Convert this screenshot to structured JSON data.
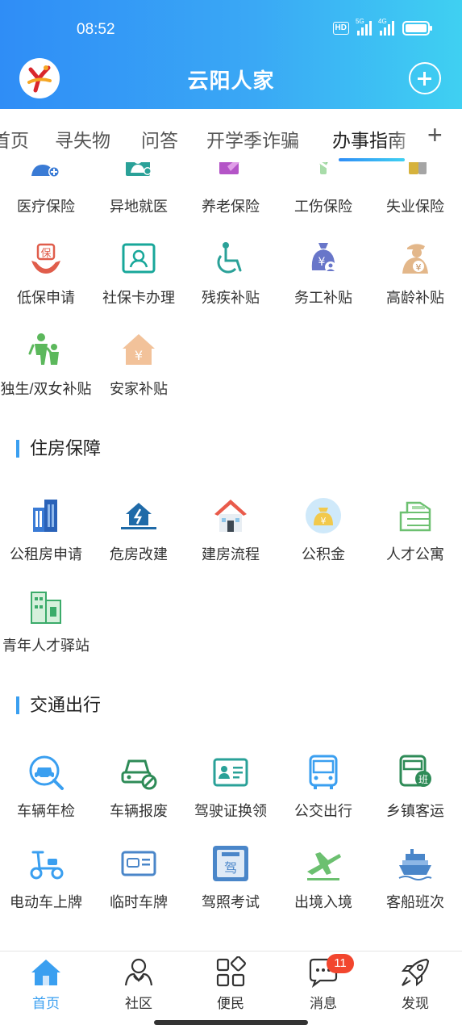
{
  "status_bar": {
    "time": "08:52",
    "hd_label": "HD",
    "net1": "5G",
    "net2": "4G"
  },
  "header": {
    "title": "云阳人家"
  },
  "tabs": [
    {
      "label": "首页"
    },
    {
      "label": "寻失物"
    },
    {
      "label": "问答"
    },
    {
      "label": "开学季诈骗"
    },
    {
      "label": "办事指南"
    }
  ],
  "sections": {
    "social_security": {
      "items": [
        {
          "label": "医疗保险",
          "icon": "medical-insurance-icon"
        },
        {
          "label": "异地就医",
          "icon": "remote-medical-icon"
        },
        {
          "label": "养老保险",
          "icon": "pension-insurance-icon"
        },
        {
          "label": "工伤保险",
          "icon": "injury-insurance-icon"
        },
        {
          "label": "失业保险",
          "icon": "unemployment-insurance-icon"
        },
        {
          "label": "低保申请",
          "icon": "subsistence-allowance-icon"
        },
        {
          "label": "社保卡办理",
          "icon": "social-security-card-icon"
        },
        {
          "label": "残疾补贴",
          "icon": "wheelchair-icon"
        },
        {
          "label": "务工补贴",
          "icon": "money-bag-icon"
        },
        {
          "label": "高龄补贴",
          "icon": "elderly-icon"
        },
        {
          "label": "独生/双女补贴",
          "icon": "family-icon"
        },
        {
          "label": "安家补贴",
          "icon": "house-yuan-icon"
        }
      ]
    },
    "housing": {
      "title": "住房保障",
      "items": [
        {
          "label": "公租房申请",
          "icon": "apartment-building-icon"
        },
        {
          "label": "危房改建",
          "icon": "dangerous-house-icon"
        },
        {
          "label": "建房流程",
          "icon": "house-icon"
        },
        {
          "label": "公积金",
          "icon": "provident-fund-icon"
        },
        {
          "label": "人才公寓",
          "icon": "talent-apartment-icon"
        },
        {
          "label": "青年人才驿站",
          "icon": "youth-station-icon"
        }
      ]
    },
    "transport": {
      "title": "交通出行",
      "items": [
        {
          "label": "车辆年检",
          "icon": "car-inspection-icon"
        },
        {
          "label": "车辆报废",
          "icon": "car-scrap-icon"
        },
        {
          "label": "驾驶证换领",
          "icon": "driver-license-icon"
        },
        {
          "label": "公交出行",
          "icon": "bus-icon"
        },
        {
          "label": "乡镇客运",
          "icon": "township-bus-icon"
        },
        {
          "label": "电动车上牌",
          "icon": "scooter-icon"
        },
        {
          "label": "临时车牌",
          "icon": "temporary-plate-icon"
        },
        {
          "label": "驾照考试",
          "icon": "driving-exam-icon"
        },
        {
          "label": "出境入境",
          "icon": "airplane-icon"
        },
        {
          "label": "客船班次",
          "icon": "ship-icon"
        }
      ]
    }
  },
  "bottom_nav": [
    {
      "label": "首页",
      "icon": "home-icon",
      "active": true
    },
    {
      "label": "社区",
      "icon": "community-icon"
    },
    {
      "label": "便民",
      "icon": "services-grid-icon"
    },
    {
      "label": "消息",
      "icon": "message-icon",
      "badge": "11"
    },
    {
      "label": "发现",
      "icon": "rocket-icon"
    }
  ],
  "colors": {
    "header_start": "#2f8df6",
    "header_end": "#3fd0f2",
    "accent": "#3a9ff0",
    "badge": "#f2462e"
  }
}
